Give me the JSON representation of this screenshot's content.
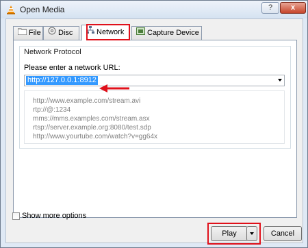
{
  "window": {
    "title": "Open Media",
    "help_label": "?",
    "close_label": "x"
  },
  "tabs": [
    {
      "label": "File",
      "icon": "folder-icon"
    },
    {
      "label": "Disc",
      "icon": "disc-icon"
    },
    {
      "label": "Network",
      "icon": "network-icon",
      "active": true
    },
    {
      "label": "Capture Device",
      "icon": "capture-device-icon"
    }
  ],
  "network": {
    "group_title": "Network Protocol",
    "prompt": "Please enter a network URL:",
    "url_value": "http://127.0.0.1:8912",
    "examples": [
      "http://www.example.com/stream.avi",
      "rtp://@:1234",
      "mms://mms.examples.com/stream.asx",
      "rtsp://server.example.org:8080/test.sdp",
      "http://www.yourtube.com/watch?v=gg64x"
    ]
  },
  "options": {
    "show_more_label": "Show more options",
    "show_more_checked": false
  },
  "buttons": {
    "play_label": "Play",
    "cancel_label": "Cancel"
  },
  "colors": {
    "highlight": "#e0101a",
    "selection": "#3399ff",
    "vlc_orange": "#f08a00"
  }
}
